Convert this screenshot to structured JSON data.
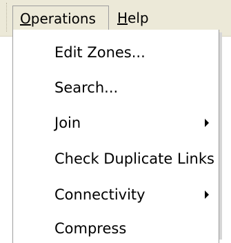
{
  "menubar": {
    "menus": [
      {
        "label": "Operations",
        "mnemonic": "O",
        "rest": "perations",
        "active": true
      },
      {
        "label": "Help",
        "mnemonic": "H",
        "rest": "elp",
        "active": false
      }
    ]
  },
  "dropdown": {
    "items": [
      {
        "label": "Edit Zones...",
        "submenu": false
      },
      {
        "label": "Search...",
        "submenu": false
      },
      {
        "label": "Join",
        "submenu": true,
        "icon": "submenu-arrow-icon"
      },
      {
        "label": "Check Duplicate Links",
        "submenu": false
      },
      {
        "label": "Connectivity",
        "submenu": true,
        "icon": "submenu-arrow-icon"
      },
      {
        "label": "Compress",
        "submenu": false
      }
    ]
  }
}
